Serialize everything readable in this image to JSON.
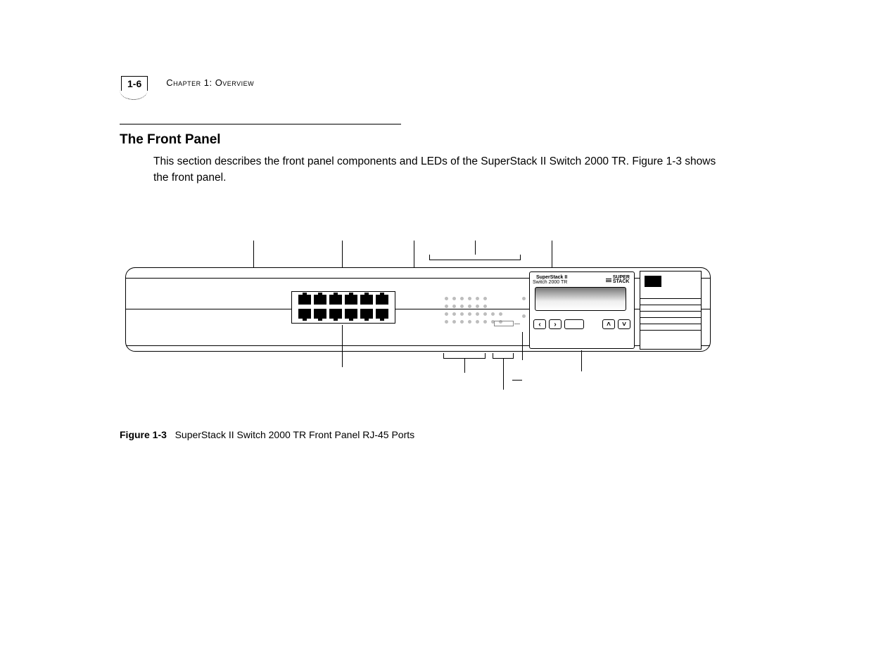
{
  "header": {
    "page_number": "1-6",
    "chapter_label": "Chapter 1: Overview"
  },
  "section": {
    "title": "The Front Panel",
    "body": "This section describes the front panel components and LEDs of the SuperStack II Switch 2000 TR. Figure 1-3 shows the front panel."
  },
  "figure": {
    "label": "Figure 1-3",
    "caption": "SuperStack II Switch 2000 TR Front Panel RJ-45 Ports"
  },
  "device": {
    "product_line1": "SuperStack II",
    "product_line2": "Switch 2000 TR",
    "brand_mark": "SUPER STACK",
    "buttons": {
      "left": "‹",
      "right": "›",
      "up": "˄",
      "down": "˅"
    }
  }
}
